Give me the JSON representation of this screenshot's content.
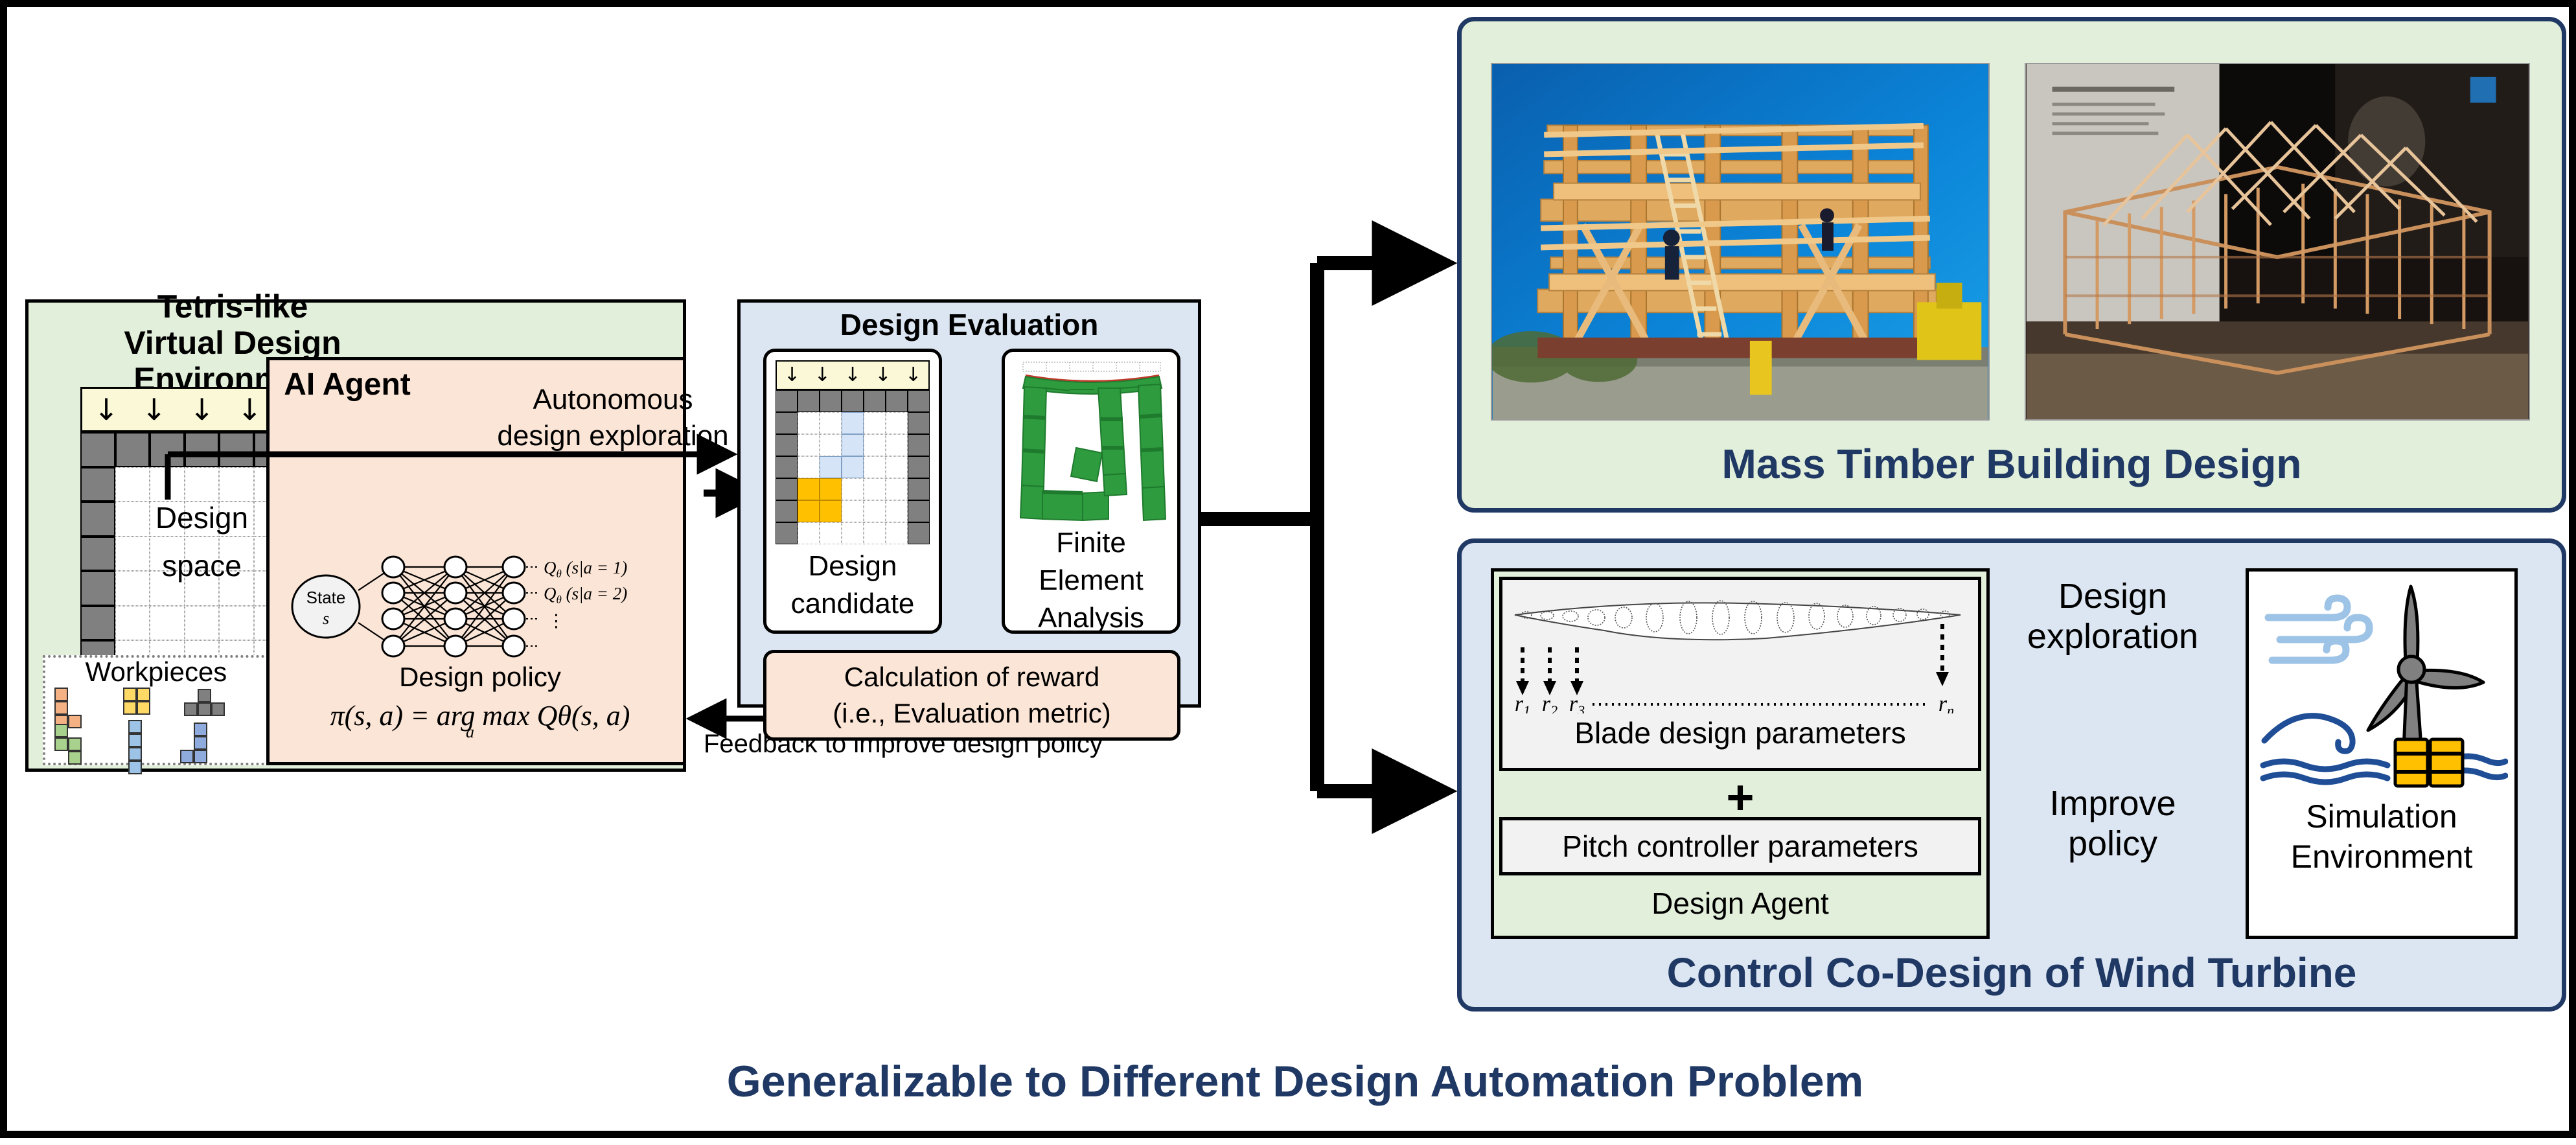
{
  "environment": {
    "title_line1": "Tetris-like",
    "title_line2": "Virtual Design Environment",
    "design_space_label_line1": "Design",
    "design_space_label_line2": "space",
    "load_arrow_glyph": "↓",
    "load_arrow_count": 5,
    "workpieces_title": "Workpieces",
    "colors": {
      "panel_bg": "#e2efda",
      "load_bar": "#fbf8d8",
      "boundary_cell": "#808080"
    },
    "workpieces": [
      {
        "name": "J-piece",
        "color": "#f4b183"
      },
      {
        "name": "O-piece",
        "color": "#ffd966"
      },
      {
        "name": "T-piece",
        "color": "#808080"
      },
      {
        "name": "S-piece",
        "color": "#a9d18e"
      },
      {
        "name": "I-piece",
        "color": "#9dc3e6"
      },
      {
        "name": "L-piece",
        "color": "#8faadc"
      }
    ]
  },
  "agent": {
    "title": "AI Agent",
    "state_label_line1": "State",
    "state_label_line2": "s",
    "q_outputs": [
      "Qθ (s|a = 1)",
      "Qθ (s|a = 2)",
      "⋮"
    ],
    "policy_title": "Design policy",
    "policy_equation": "π(s, a) = arg max Qθ(s, a)",
    "policy_equation_sub": "a",
    "panel_color": "#fbe5d6"
  },
  "flow": {
    "autonomous_label_line1": "Autonomous",
    "autonomous_label_line2": "design exploration",
    "feedback_label": "Feedback to improve design policy"
  },
  "evaluation": {
    "title": "Design Evaluation",
    "panel_color": "#dce6f2",
    "candidate": {
      "label_line1": "Design",
      "label_line2": "candidate",
      "load_arrow_glyph": "↓",
      "load_arrow_count": 5,
      "filled_blue_color": "#d6e4f7",
      "filled_orange_color": "#ffc000"
    },
    "fea": {
      "label_line1": "Finite Element",
      "label_line2": "Analysis",
      "mesh_color": "#2e9b3f",
      "mesh_dark_color": "#1e7a2c"
    },
    "reward": {
      "line1": "Calculation of reward",
      "line2": "(i.e., Evaluation metric)",
      "color": "#fbe5d6"
    }
  },
  "timber": {
    "title": "Mass Timber Building Design",
    "panel_color": "#e2efda",
    "border_color": "#1f3864",
    "image1_caption": "mass-timber-construction-photo",
    "image2_caption": "timber-frame-model-photo"
  },
  "turbine": {
    "title": "Control Co-Design of Wind Turbine",
    "panel_color": "#dce6f2",
    "border_color": "#1f3864",
    "blade_label": "Blade design parameters",
    "blade_radii": [
      "r₁",
      "r₂",
      "r₃",
      "rₙ"
    ],
    "plus": "+",
    "pitch_label": "Pitch controller parameters",
    "agent_label": "Design Agent",
    "design_exploration_line1": "Design",
    "design_exploration_line2": "exploration",
    "improve_policy_line1": "Improve",
    "improve_policy_line2": "policy",
    "sim_label_line1": "Simulation",
    "sim_label_line2": "Environment"
  },
  "footer": {
    "title": "Generalizable to Different Design Automation Problem",
    "color": "#1f3864"
  }
}
